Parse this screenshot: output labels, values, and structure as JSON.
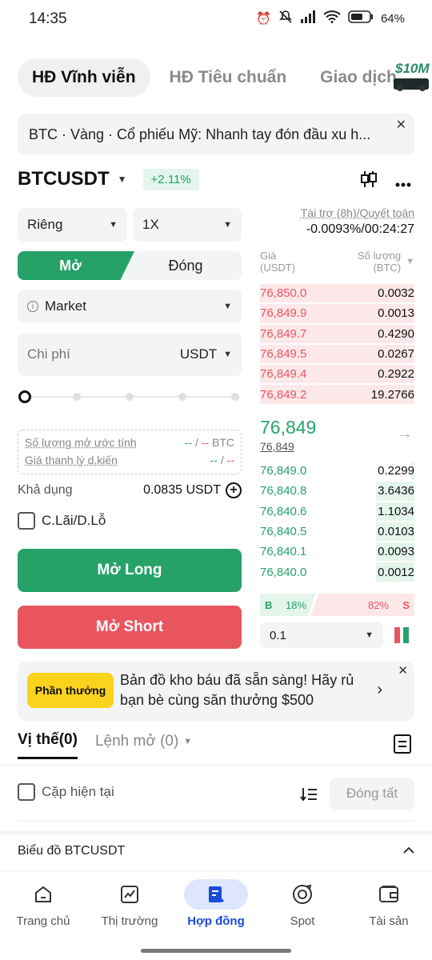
{
  "status": {
    "time": "14:35",
    "battery": "64%"
  },
  "tabs": [
    {
      "label": "HĐ Vĩnh viễn"
    },
    {
      "label": "HĐ Tiêu chuẩn"
    },
    {
      "label": "Giao dịch"
    }
  ],
  "promo_badge": {
    "text": "$10M"
  },
  "banner": {
    "text": "BTC · Vàng · Cổ phiếu Mỹ: Nhanh tay đón đầu xu h..."
  },
  "symbol": {
    "name": "BTCUSDT",
    "change": "+2.11%"
  },
  "form": {
    "margin_mode": "Riêng",
    "leverage": "1X",
    "open_label": "Mở",
    "close_label": "Đóng",
    "order_type": "Market",
    "cost_placeholder": "Chi phí",
    "cost_unit": "USDT",
    "est_qty_label": "Số lượng mở ước tính",
    "est_qty_long": "--",
    "est_qty_sep": "/",
    "est_qty_short": "--",
    "est_qty_unit": "BTC",
    "liq_label": "Giá thanh lý d.kiến",
    "liq_long": "--",
    "liq_sep": "/",
    "liq_short": "--",
    "available_label": "Khả dụng",
    "available_value": "0.0835 USDT",
    "tpsl_label": "C.Lãi/D.Lỗ",
    "long_button": "Mở Long",
    "short_button": "Mở Short"
  },
  "funding": {
    "label": "Tài trợ (8h)/Quyết toán",
    "value": "-0.0093%/00:24:27"
  },
  "orderbook": {
    "price_header": "Giá",
    "price_unit": "(USDT)",
    "qty_header": "Số lượng",
    "qty_unit": "(BTC)",
    "asks": [
      {
        "price": "76,850.0",
        "qty": "0.0032",
        "depth": 1.0
      },
      {
        "price": "76,849.9",
        "qty": "0.0013",
        "depth": 1.0
      },
      {
        "price": "76,849.7",
        "qty": "0.4290",
        "depth": 1.0
      },
      {
        "price": "76,849.5",
        "qty": "0.0267",
        "depth": 1.0
      },
      {
        "price": "76,849.4",
        "qty": "0.2922",
        "depth": 1.0
      },
      {
        "price": "76,849.2",
        "qty": "19.2766",
        "depth": 1.0
      }
    ],
    "last_price": "76,849",
    "mark_price": "76,849",
    "bids": [
      {
        "price": "76,849.0",
        "qty": "0.2299",
        "depth": 0.02
      },
      {
        "price": "76,840.8",
        "qty": "3.6436",
        "depth": 0.25
      },
      {
        "price": "76,840.6",
        "qty": "1.1034",
        "depth": 0.25
      },
      {
        "price": "76,840.5",
        "qty": "0.0103",
        "depth": 0.25
      },
      {
        "price": "76,840.1",
        "qty": "0.0093",
        "depth": 0.25
      },
      {
        "price": "76,840.0",
        "qty": "0.0012",
        "depth": 0.25
      }
    ],
    "buy_label": "B",
    "buy_pct": "18%",
    "sell_pct": "82%",
    "sell_label": "S",
    "precision": "0.1"
  },
  "reward": {
    "tag": "Phần thưởng",
    "text": "Bản đồ kho báu đã sẵn sàng! Hãy rủ bạn bè cùng săn thưởng $500"
  },
  "positions": {
    "tab_positions": "Vị thế(0)",
    "tab_orders": "Lệnh mở (0)",
    "current_pair_label": "Cặp hiện tại",
    "close_all": "Đóng tất"
  },
  "chart_row": {
    "label": "Biểu đồ BTCUSDT"
  },
  "nav": [
    {
      "label": "Trang chủ"
    },
    {
      "label": "Thị trường"
    },
    {
      "label": "Hợp đồng"
    },
    {
      "label": "Spot"
    },
    {
      "label": "Tài sản"
    }
  ],
  "colors": {
    "green": "#26a269",
    "red": "#e8555f",
    "accent": "#1a4cd6",
    "reward": "#fbd21c"
  }
}
